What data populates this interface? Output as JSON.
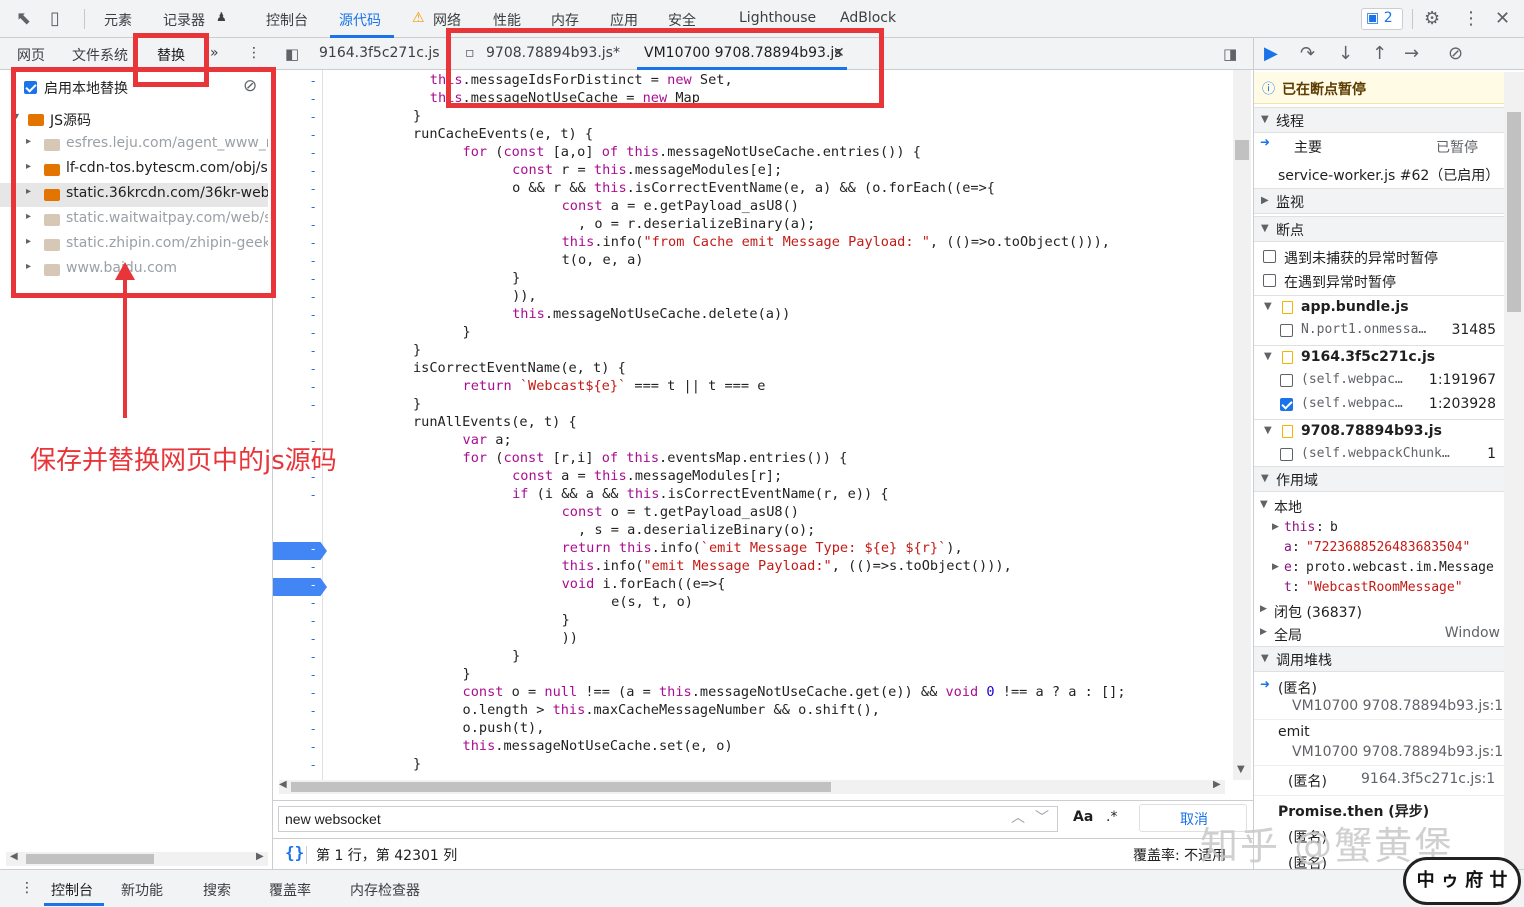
{
  "toolbar": {
    "tabs": [
      "元素",
      "记录器",
      "控制台",
      "源代码",
      "网络",
      "性能",
      "内存",
      "应用",
      "安全",
      "Lighthouse",
      "AdBlock"
    ],
    "issues_count": "2"
  },
  "left_panel": {
    "tabs": [
      "网页",
      "文件系统",
      "替换"
    ],
    "more": "»",
    "enable_override_label": "启用本地替换",
    "enable_override_checked": true,
    "root_folder": "JS源码",
    "folders": [
      {
        "label": "esfres.leju.com/agent_www_ne",
        "muted": true
      },
      {
        "label": "lf-cdn-tos.bytescm.com/obj/sta",
        "muted": false
      },
      {
        "label": "static.36krcdn.com/36kr-web/s",
        "muted": false
      },
      {
        "label": "static.waitwaitpay.com/web/sd",
        "muted": true
      },
      {
        "label": "static.zhipin.com/zhipin-geek/v",
        "muted": true
      },
      {
        "label": "www.baidu.com",
        "muted": true
      }
    ]
  },
  "editor": {
    "tabs": [
      "9164.3f5c271c.js",
      "9708.78894b93.js*",
      "VM10700 9708.78894b93.js"
    ],
    "code_lines": [
      "this.messageIdsForDistinct = new Set,",
      "this.messageNotUseCache = new Map",
      "}",
      "runCacheEvents(e, t) {",
      "    for (const [a,o] of this.messageNotUseCache.entries()) {",
      "        const r = this.messageModules[e];",
      "        o && r && this.isCorrectEventName(e, a) && (o.forEach((e=>{",
      "            const a = e.getPayload_asU8()",
      "              , o = r.deserializeBinary(a);",
      "            this.info(\"from Cache emit Message Payload: \", (()=>o.toObject())),",
      "            t(o, e, a)",
      "        }",
      "        )),",
      "        this.messageNotUseCache.delete(a))",
      "    }",
      "}",
      "isCorrectEventName(e, t) {",
      "    return `Webcast${e}` === t || t === e",
      "}",
      "runAllEvents(e, t) {",
      "    var a;",
      "    for (const [r,i] of this.eventsMap.entries()) {",
      "        const a = this.messageModules[r];",
      "        if (i && a && this.isCorrectEventName(r, e)) {",
      "            const o = t.getPayload_asU8()",
      "              , s = a.deserializeBinary(o);",
      "            return this.info(`emit Message Type: ${e} ${r}`),",
      "            this.info(\"emit Message Payload:\", (()=>s.toObject())),",
      "            void i.forEach((e=>{",
      "                e(s, t, o)",
      "            }",
      "            ))",
      "        }",
      "    }",
      "    const o = null !== (a = this.messageNotUseCache.get(e)) && void 0 !== a ? a : [];",
      "    o.length > this.maxCacheMessageNumber && o.shift(),",
      "    o.push(t),",
      "    this.messageNotUseCache.set(e, o)",
      "}"
    ],
    "search_value": "new websocket",
    "search_case_label": "Aa",
    "search_regex_label": ".*",
    "search_cancel": "取消",
    "status_position": "第 1 行，第 42301 列",
    "status_coverage": "覆盖率: 不适用",
    "pretty_print": "{}"
  },
  "right_panel": {
    "paused_label": "已在断点暂停",
    "threads_title": "线程",
    "thread_main": "主要",
    "thread_main_state": "已暂停",
    "thread_worker": "service-worker.js #62（已启用）",
    "watch_title": "监视",
    "breakpoints_title": "断点",
    "pause_uncaught": "遇到未捕获的异常时暂停",
    "pause_caught": "在遇到异常时暂停",
    "bp_files": [
      {
        "file": "app.bundle.js",
        "items": [
          {
            "code": "N.port1.onmessa…",
            "line": "31485",
            "checked": false
          }
        ]
      },
      {
        "file": "9164.3f5c271c.js",
        "items": [
          {
            "code": "(self.webpac…",
            "line": "1:191967",
            "checked": false
          },
          {
            "code": "(self.webpac…",
            "line": "1:203928",
            "checked": true
          }
        ]
      },
      {
        "file": "9708.78894b93.js",
        "items": [
          {
            "code": "(self.webpackChunk…",
            "line": "1",
            "checked": false
          }
        ]
      }
    ],
    "scope_title": "作用域",
    "scope_local": "本地",
    "scope_vars": [
      {
        "name": "this",
        "value": "b",
        "arrow": true
      },
      {
        "name": "a",
        "value": "\"7223688526483683504\"",
        "arrow": false
      },
      {
        "name": "e",
        "value": "proto.webcast.im.Message",
        "arrow": true
      },
      {
        "name": "t",
        "value": "\"WebcastRoomMessage\"",
        "arrow": false
      }
    ],
    "scope_closure": "闭包 (36837)",
    "scope_global": "全局",
    "scope_global_value": "Window",
    "callstack_title": "调用堆栈",
    "frames": [
      {
        "fn": "(匿名)",
        "loc": "VM10700 9708.78894b93.js:1"
      },
      {
        "fn": "emit",
        "loc": "VM10700 9708.78894b93.js:1"
      },
      {
        "fn": "(匿名)",
        "loc": "9164.3f5c271c.js:1"
      }
    ],
    "promise_then": "Promise.then (异步)",
    "frames_tail": [
      "(匿名)",
      "(匿名)"
    ]
  },
  "drawer": {
    "tabs": [
      "控制台",
      "新功能",
      "搜索",
      "覆盖率",
      "内存检查器"
    ]
  },
  "annotation": {
    "text": "保存并替换网页中的js源码"
  },
  "watermark": "知乎 @蟹黄堡",
  "stamp": "中 ゥ 府 廿"
}
